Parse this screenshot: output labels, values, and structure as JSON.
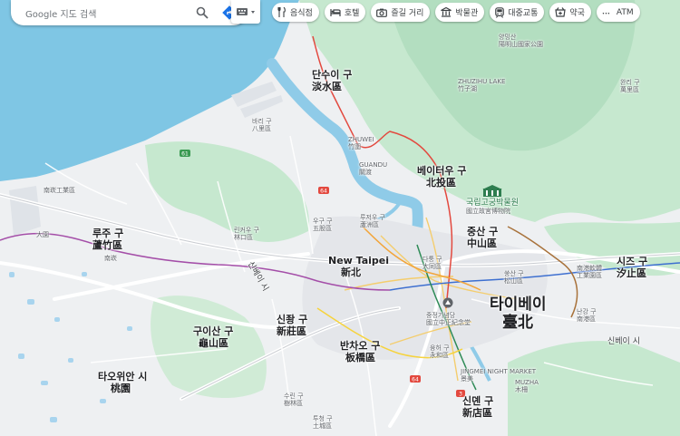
{
  "search": {
    "placeholder": "Google 지도 검색"
  },
  "chips": [
    {
      "label": "음식점",
      "icon": "restaurant-icon"
    },
    {
      "label": "호텔",
      "icon": "hotel-icon"
    },
    {
      "label": "즐길 거리",
      "icon": "camera-icon"
    },
    {
      "label": "박물관",
      "icon": "museum-icon"
    },
    {
      "label": "대중교통",
      "icon": "transit-icon"
    },
    {
      "label": "약국",
      "icon": "pharmacy-icon"
    },
    {
      "label": "ATM",
      "icon": "atm-icon"
    }
  ],
  "labels": {
    "danshui": {
      "ko": "단수이 구",
      "zh": "淡水區"
    },
    "beitou": {
      "ko": "베이터우 구",
      "zh": "北投區"
    },
    "zhongshan": {
      "ko": "중산 구",
      "zh": "中山區"
    },
    "xizhi": {
      "ko": "시즈 구",
      "zh": "汐止區"
    },
    "luzhu": {
      "ko": "루주 구",
      "zh": "蘆竹區"
    },
    "newtaipei": {
      "en": "New Taipei",
      "zh": "新北"
    },
    "taipei": {
      "ko": "타이베이",
      "zh": "臺北"
    },
    "xinzhuang": {
      "ko": "신좡 구",
      "zh": "新莊區"
    },
    "guishan": {
      "ko": "구이산 구",
      "zh": "龜山區"
    },
    "banqiao": {
      "ko": "반차오 구",
      "zh": "板橋區"
    },
    "taoyuan": {
      "ko": "타오위안 시",
      "zh": "桃園"
    },
    "xindian": {
      "ko": "신뎬 구",
      "zh": "新店區"
    },
    "museum": {
      "ko": "국립고궁박물원",
      "zh": "國立故宮博物院"
    },
    "bali": {
      "ko": "바리 구",
      "zh": "八里區"
    },
    "wugu": {
      "ko": "우구 구",
      "zh": "五股區"
    },
    "luzhou": {
      "ko": "루저우 구",
      "zh": "蘆洲區"
    },
    "linkou": {
      "ko": "린커우 구",
      "zh": "林口區"
    },
    "zhuwei": {
      "en": "ZHUWEI",
      "zh": "竹圍"
    },
    "guandu": {
      "en": "GUANDU",
      "zh": "關渡"
    },
    "zhuzihu": {
      "en": "ZHUZIHU LAKE",
      "zh": "竹子湖"
    },
    "yangming": {
      "ko": "양밍산",
      "zh": "陽明山國家公園"
    },
    "wanli": {
      "ko": "완리 구",
      "zh": "萬里區"
    },
    "tucheng": {
      "ko": "투청 구",
      "zh": "土城區"
    },
    "shulin": {
      "ko": "수린 구",
      "zh": "樹林區"
    },
    "yonghe": {
      "ko": "융허 구",
      "zh": "永和區"
    },
    "jingmei": {
      "en": "JINGMEI NIGHT MARKET",
      "zh": "景美"
    },
    "muzha": {
      "en": "MUZHA",
      "zh": "木柵"
    },
    "songshan": {
      "ko": "쑹산 구",
      "zh": "松山區"
    },
    "nangang": {
      "ko": "난강 구",
      "zh": "南港區"
    },
    "datong": {
      "ko": "다퉁 구",
      "zh": "大同區"
    },
    "cks": {
      "ko": "중정기념당",
      "zh": "國立中正紀念堂"
    },
    "xinbei_city": {
      "ko": "신베이 시"
    },
    "xinbei_vert": {
      "ko": "신베이 시"
    },
    "airport_area": {
      "zh": "南崁工業區"
    },
    "dayuan": {
      "zh": "大園"
    },
    "nankan": {
      "zh": "南崁"
    },
    "shilin_ind": {
      "zh": "南港軟體\n工業園區"
    }
  },
  "road_shields": [
    "61",
    "64",
    "64",
    "3"
  ]
}
